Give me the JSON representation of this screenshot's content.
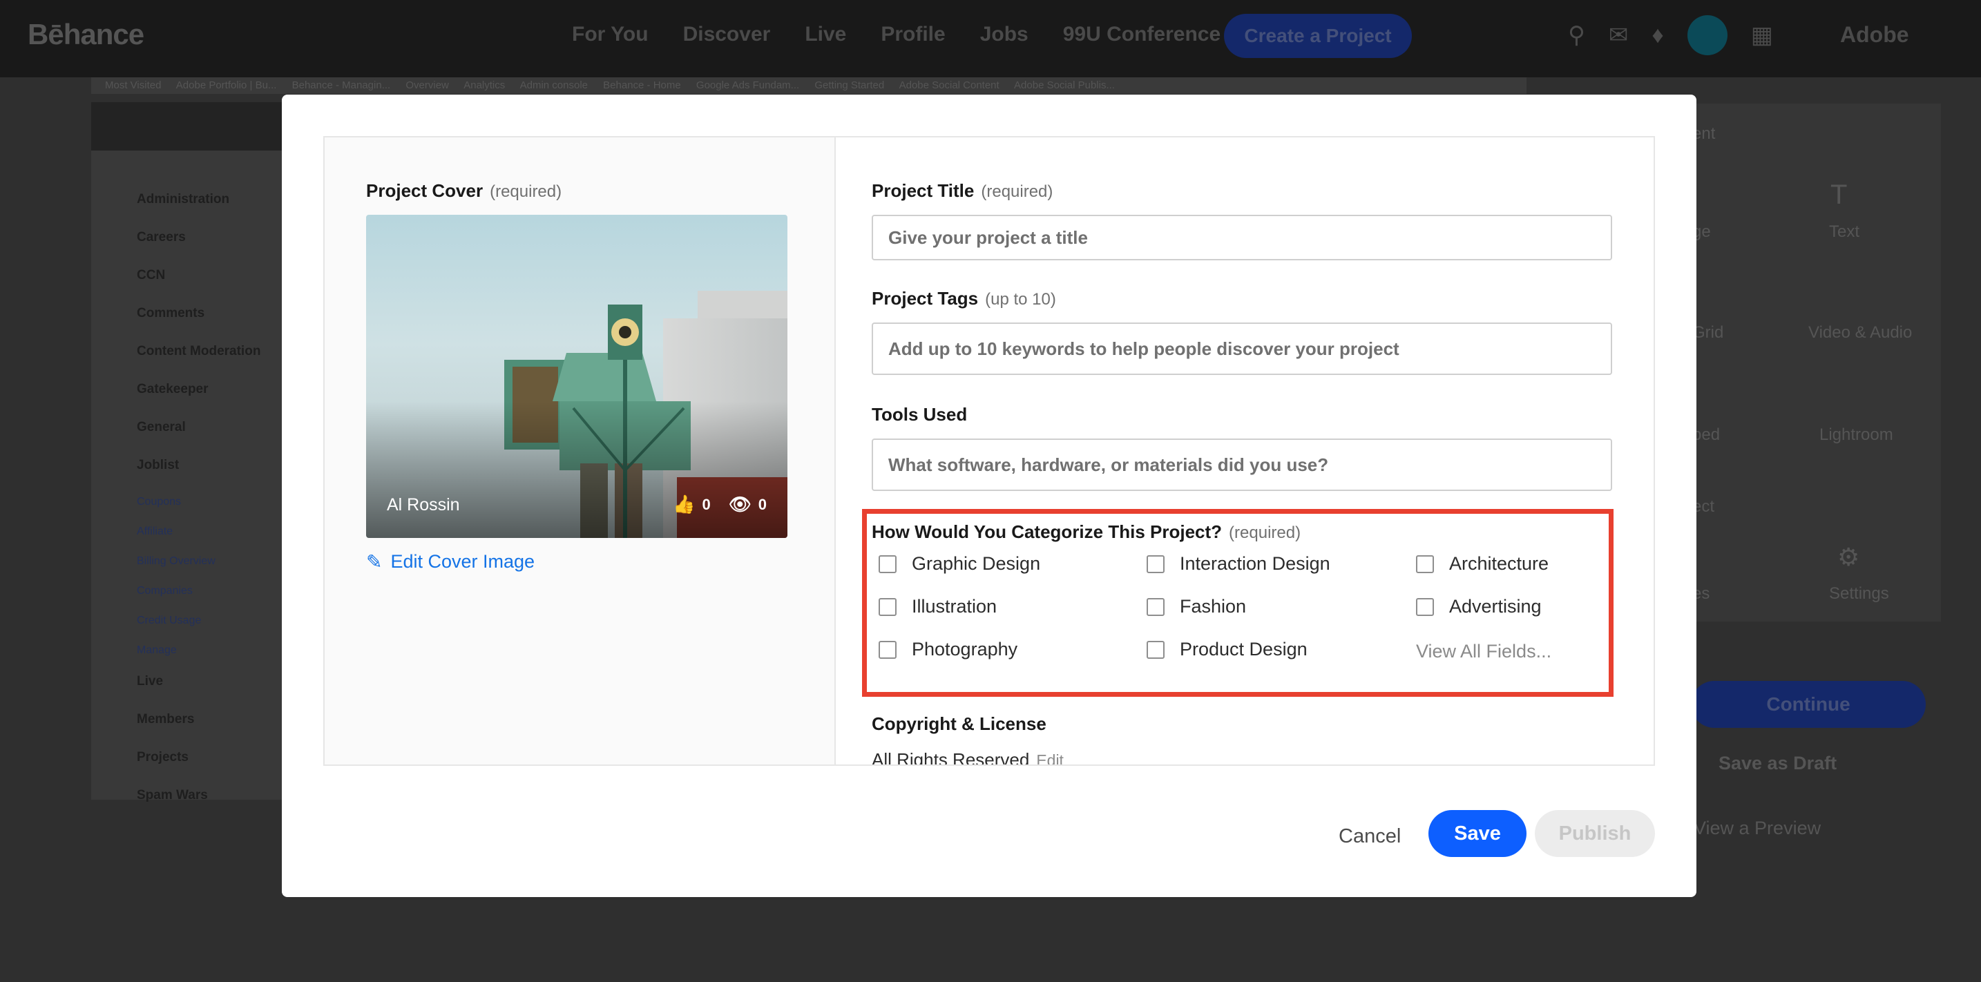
{
  "app": {
    "logo": "Bēhance",
    "nav": [
      "For You",
      "Discover",
      "Live",
      "Profile",
      "Jobs",
      "99U Conference"
    ],
    "create_project": "Create a Project",
    "adobe": "Adobe"
  },
  "bookmarks": [
    "Most Visited",
    "Adobe Portfolio | Bu...",
    "Behance - Managin...",
    "Overview",
    "Analytics",
    "Admin console",
    "Behance - Home",
    "Google Ads Fundam...",
    "Getting Started",
    "Adobe Social Content",
    "Adobe Social Publis..."
  ],
  "bg_sidebar": [
    {
      "label": "Administration",
      "sub": false
    },
    {
      "label": "Careers",
      "sub": false
    },
    {
      "label": "CCN",
      "sub": false
    },
    {
      "label": "Comments",
      "sub": false
    },
    {
      "label": "Content Moderation",
      "sub": false
    },
    {
      "label": "Gatekeeper",
      "sub": false
    },
    {
      "label": "General",
      "sub": false
    },
    {
      "label": "Joblist",
      "sub": false
    },
    {
      "label": "Coupons",
      "sub": true
    },
    {
      "label": "Affiliate",
      "sub": true
    },
    {
      "label": "Billing Overview",
      "sub": true
    },
    {
      "label": "Companies",
      "sub": true
    },
    {
      "label": "Credit Usage",
      "sub": true
    },
    {
      "label": "Manage",
      "sub": true
    },
    {
      "label": "Live",
      "sub": false
    },
    {
      "label": "Members",
      "sub": false
    },
    {
      "label": "Projects",
      "sub": false
    },
    {
      "label": "Spam Wars",
      "sub": false
    }
  ],
  "bg_right": {
    "header": "ent",
    "tools": [
      "ge",
      "Text",
      "Grid",
      "Video & Audio",
      "bed",
      "Lightroom",
      "es",
      "Settings"
    ],
    "section": "ect",
    "continue": "Continue",
    "save_draft": "Save as Draft",
    "preview": "View a Preview"
  },
  "modal": {
    "cover": {
      "label": "Project Cover",
      "required": "(required)",
      "owner": "Al Rossin",
      "likes": "0",
      "views": "0",
      "edit_label": "Edit Cover Image"
    },
    "title": {
      "label": "Project Title",
      "required": "(required)",
      "placeholder": "Give your project a title"
    },
    "tags": {
      "label": "Project Tags",
      "hint": "(up to 10)",
      "placeholder": "Add up to 10 keywords to help people discover your project"
    },
    "tools": {
      "label": "Tools Used",
      "placeholder": "What software, hardware, or materials did you use?"
    },
    "categorize": {
      "label": "How Would You Categorize This Project?",
      "required": "(required)",
      "options": [
        "Graphic Design",
        "Interaction Design",
        "Architecture",
        "Illustration",
        "Fashion",
        "Advertising",
        "Photography",
        "Product Design"
      ],
      "view_all": "View All Fields..."
    },
    "license": {
      "label": "Copyright & License",
      "value": "All Rights Reserved",
      "edit": "Edit"
    },
    "buttons": {
      "cancel": "Cancel",
      "save": "Save",
      "publish": "Publish"
    }
  }
}
